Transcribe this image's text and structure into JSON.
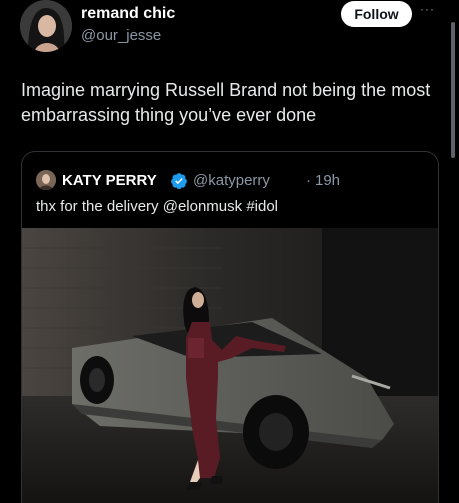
{
  "tweet": {
    "author_name": "remand chic",
    "author_handle": "@our_jesse",
    "follow_label": "Follow",
    "more_icon": "more-icon",
    "text": "Imagine marrying Russell Brand not being the most embarrassing thing you’ve ever done"
  },
  "quote": {
    "author_name": "KATY PERRY",
    "verified_icon": "verified-badge-icon",
    "author_handle": "@katyperry",
    "separator": "·",
    "timestamp": "19h",
    "text": "thx for the delivery @elonmusk #idol"
  },
  "colors": {
    "background": "#000000",
    "text_primary": "#e7e9ea",
    "text_secondary": "#8b98a5",
    "verified_blue": "#1d9bf0",
    "card_border": "#2f3336",
    "follow_bg": "#ffffff"
  }
}
